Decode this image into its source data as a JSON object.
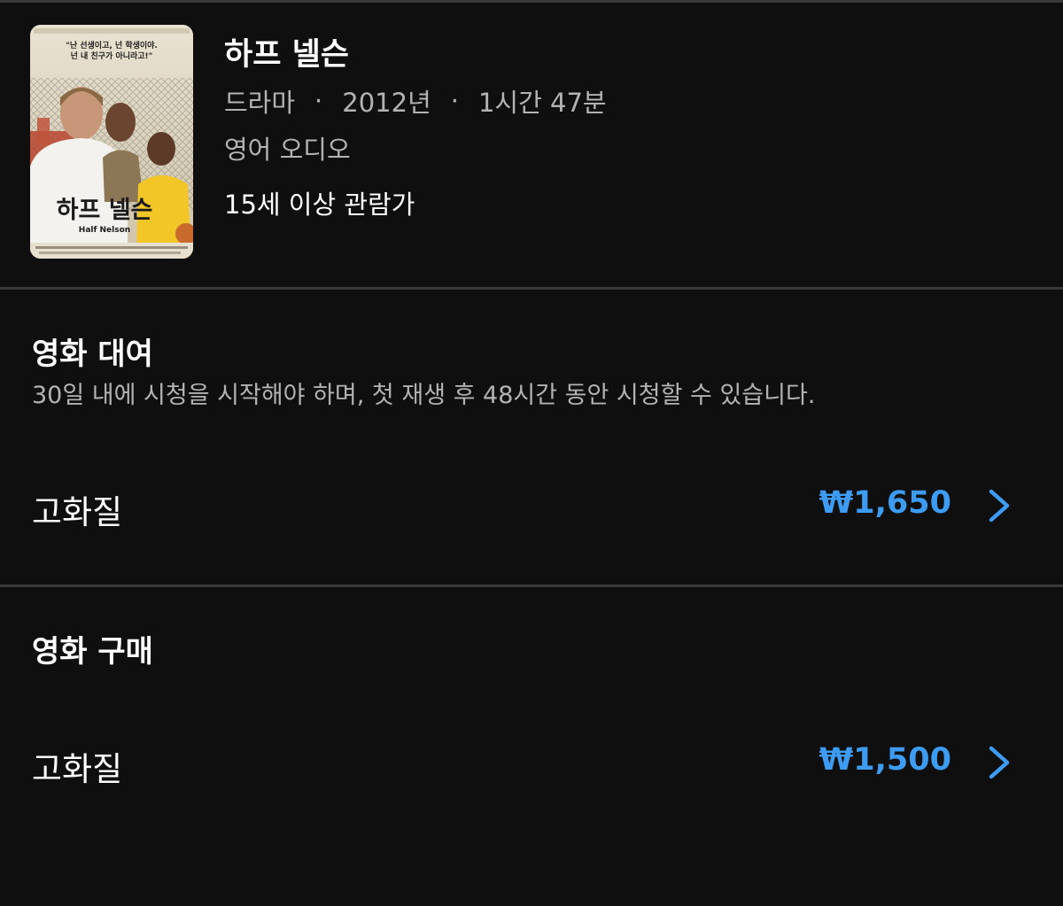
{
  "movie": {
    "title": "하프 넬슨",
    "genre": "드라마",
    "year": "2012년",
    "duration": "1시간 47분",
    "separator": "·",
    "audio": "영어 오디오",
    "rating": "15세 이상 관람가",
    "poster": {
      "tagline_line1": "\"난 선생이고, 넌 학생이야.",
      "tagline_line2": "넌 내 친구가 아니라고!\"",
      "title_ko": "하프 넬슨",
      "title_en": "Half Nelson"
    }
  },
  "rent": {
    "title": "영화 대여",
    "description": "30일 내에 시청을 시작해야 하며, 첫 재생 후 48시간 동안 시청할 수 있습니다.",
    "options": [
      {
        "label": "고화질",
        "price": "₩1,650"
      }
    ]
  },
  "buy": {
    "title": "영화 구매",
    "options": [
      {
        "label": "고화질",
        "price": "₩1,500"
      }
    ]
  },
  "colors": {
    "background": "#0f0f10",
    "price_accent": "#3d9bf2",
    "divider": "#3a3a3c",
    "secondary_text": "#b3b3b3"
  },
  "icons": {
    "chevron": "chevron-right-icon"
  }
}
